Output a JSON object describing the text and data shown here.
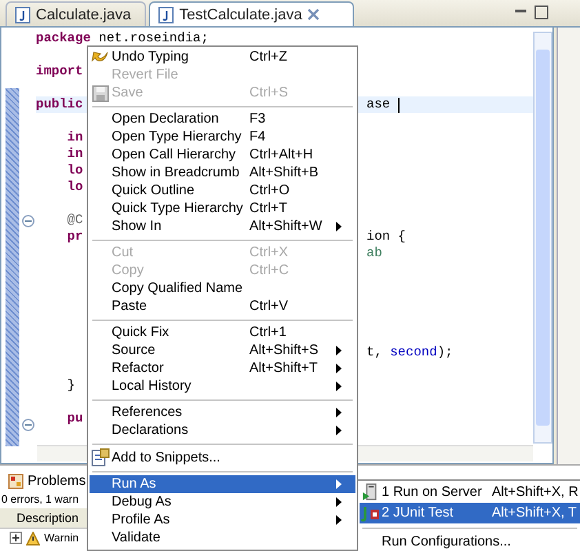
{
  "tabs": [
    {
      "label": "Calculate.java",
      "selected": false
    },
    {
      "label": "TestCalculate.java",
      "selected": true
    }
  ],
  "editor": {
    "lines": [
      {
        "kind": "code",
        "left": [
          {
            "kind": "keyword",
            "text": "package"
          },
          {
            "kind": "plain",
            "text": " net.roseindia;"
          }
        ]
      },
      {
        "kind": "blank"
      },
      {
        "kind": "code",
        "left": [
          {
            "kind": "keyword",
            "text": "import"
          }
        ]
      },
      {
        "kind": "blank"
      },
      {
        "kind": "code",
        "left": [
          {
            "kind": "keyword",
            "text": "public"
          }
        ],
        "right": [
          {
            "kind": "plain",
            "text": "ase"
          }
        ],
        "current": true
      },
      {
        "kind": "blank"
      },
      {
        "kind": "code",
        "left": [
          {
            "kind": "keyword",
            "text": "    in"
          }
        ]
      },
      {
        "kind": "code",
        "left": [
          {
            "kind": "keyword",
            "text": "    in"
          }
        ]
      },
      {
        "kind": "code",
        "left": [
          {
            "kind": "keyword",
            "text": "    lo"
          }
        ]
      },
      {
        "kind": "code",
        "left": [
          {
            "kind": "keyword",
            "text": "    lo"
          }
        ]
      },
      {
        "kind": "blank"
      },
      {
        "kind": "code",
        "left": [
          {
            "kind": "annotation",
            "text": "    @C"
          }
        ]
      },
      {
        "kind": "code",
        "left": [
          {
            "kind": "keyword",
            "text": "    pr"
          }
        ],
        "right": [
          {
            "kind": "plain",
            "text": "ion {"
          }
        ]
      },
      {
        "kind": "code",
        "right": [
          {
            "kind": "comment",
            "text": "ab"
          }
        ]
      },
      {
        "kind": "blank"
      },
      {
        "kind": "blank"
      },
      {
        "kind": "blank"
      },
      {
        "kind": "blank"
      },
      {
        "kind": "blank"
      },
      {
        "kind": "code",
        "right": [
          {
            "kind": "plain",
            "text": "t, "
          },
          {
            "kind": "field",
            "text": "second"
          },
          {
            "kind": "plain",
            "text": ");"
          }
        ]
      },
      {
        "kind": "blank"
      },
      {
        "kind": "code",
        "left": [
          {
            "kind": "plain",
            "text": "    }"
          }
        ]
      },
      {
        "kind": "blank"
      },
      {
        "kind": "code",
        "left": [
          {
            "kind": "keyword",
            "text": "    pu"
          }
        ]
      }
    ]
  },
  "problems": {
    "tab": "Problems",
    "summary": "0 errors, 1 warn",
    "column": "Description",
    "row": "Warnin"
  },
  "context_menu": [
    {
      "kind": "item",
      "label": "Undo Typing",
      "shortcut": "Ctrl+Z",
      "disabled": false,
      "submenu": false,
      "selected": false
    },
    {
      "kind": "item",
      "label": "Revert File",
      "disabled": true,
      "submenu": false,
      "selected": false
    },
    {
      "kind": "item",
      "label": "Save",
      "shortcut": "Ctrl+S",
      "disabled": true,
      "submenu": false,
      "selected": false
    },
    {
      "kind": "separator"
    },
    {
      "kind": "item",
      "label": "Open Declaration",
      "shortcut": "F3",
      "disabled": false,
      "submenu": false,
      "selected": false
    },
    {
      "kind": "item",
      "label": "Open Type Hierarchy",
      "shortcut": "F4",
      "disabled": false,
      "submenu": false,
      "selected": false
    },
    {
      "kind": "item",
      "label": "Open Call Hierarchy",
      "shortcut": "Ctrl+Alt+H",
      "disabled": false,
      "submenu": false,
      "selected": false
    },
    {
      "kind": "item",
      "label": "Show in Breadcrumb",
      "shortcut": "Alt+Shift+B",
      "disabled": false,
      "submenu": false,
      "selected": false
    },
    {
      "kind": "item",
      "label": "Quick Outline",
      "shortcut": "Ctrl+O",
      "disabled": false,
      "submenu": false,
      "selected": false
    },
    {
      "kind": "item",
      "label": "Quick Type Hierarchy",
      "shortcut": "Ctrl+T",
      "disabled": false,
      "submenu": false,
      "selected": false
    },
    {
      "kind": "item",
      "label": "Show In",
      "shortcut": "Alt+Shift+W",
      "disabled": false,
      "submenu": true,
      "selected": false
    },
    {
      "kind": "separator"
    },
    {
      "kind": "item",
      "label": "Cut",
      "shortcut": "Ctrl+X",
      "disabled": true,
      "submenu": false,
      "selected": false
    },
    {
      "kind": "item",
      "label": "Copy",
      "shortcut": "Ctrl+C",
      "disabled": true,
      "submenu": false,
      "selected": false
    },
    {
      "kind": "item",
      "label": "Copy Qualified Name",
      "disabled": false,
      "submenu": false,
      "selected": false
    },
    {
      "kind": "item",
      "label": "Paste",
      "shortcut": "Ctrl+V",
      "disabled": false,
      "submenu": false,
      "selected": false
    },
    {
      "kind": "separator"
    },
    {
      "kind": "item",
      "label": "Quick Fix",
      "shortcut": "Ctrl+1",
      "disabled": false,
      "submenu": false,
      "selected": false
    },
    {
      "kind": "item",
      "label": "Source",
      "shortcut": "Alt+Shift+S",
      "disabled": false,
      "submenu": true,
      "selected": false
    },
    {
      "kind": "item",
      "label": "Refactor",
      "shortcut": "Alt+Shift+T",
      "disabled": false,
      "submenu": true,
      "selected": false
    },
    {
      "kind": "item",
      "label": "Local History",
      "disabled": false,
      "submenu": true,
      "selected": false
    },
    {
      "kind": "separator"
    },
    {
      "kind": "item",
      "label": "References",
      "disabled": false,
      "submenu": true,
      "selected": false
    },
    {
      "kind": "item",
      "label": "Declarations",
      "disabled": false,
      "submenu": true,
      "selected": false
    },
    {
      "kind": "separator"
    },
    {
      "kind": "item",
      "label": "Add to Snippets...",
      "disabled": false,
      "submenu": false,
      "selected": false
    },
    {
      "kind": "separator"
    },
    {
      "kind": "item",
      "label": "Run As",
      "disabled": false,
      "submenu": true,
      "selected": true
    },
    {
      "kind": "item",
      "label": "Debug As",
      "disabled": false,
      "submenu": true,
      "selected": false
    },
    {
      "kind": "item",
      "label": "Profile As",
      "disabled": false,
      "submenu": true,
      "selected": false
    },
    {
      "kind": "item",
      "label": "Validate",
      "disabled": false,
      "submenu": false,
      "selected": false
    }
  ],
  "submenu": [
    {
      "kind": "item",
      "label": "1 Run on Server",
      "shortcut": "Alt+Shift+X, R",
      "selected": false
    },
    {
      "kind": "item",
      "label": "2 JUnit Test",
      "shortcut": "Alt+Shift+X, T",
      "selected": true
    },
    {
      "kind": "separator"
    },
    {
      "kind": "item",
      "label": "Run Configurations...",
      "selected": false
    }
  ]
}
